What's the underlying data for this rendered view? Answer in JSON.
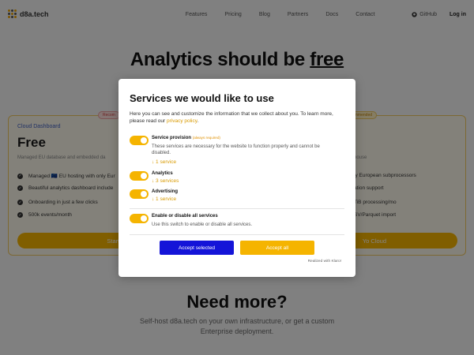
{
  "nav": {
    "logo": "d8a.tech",
    "links": [
      "Features",
      "Pricing",
      "Blog",
      "Partners",
      "Docs",
      "Contact"
    ],
    "github": "GitHub",
    "login": "Log in"
  },
  "hero": {
    "title_prefix": "Analytics should be ",
    "title_emph": "free"
  },
  "cards": {
    "left": {
      "ribbon": "Recom",
      "label": "Cloud Dashboard",
      "title": "Free",
      "sub": "Managed EU database and embedded da",
      "features": [
        "Managed 🇪🇺 EU hosting with only Eur",
        "Beautiful analytics dashboard include",
        "Onboarding in just a few clicks",
        "500k events/month"
      ],
      "button": "Start with"
    },
    "right": {
      "ribbon": "mmended",
      "sub": "house",
      "features": [
        "ly European subprocessors",
        "ation support",
        "TiB processing/mo",
        "SV/Parquet import"
      ],
      "button": "Yo Cloud"
    }
  },
  "bottom": {
    "title": "Need more?",
    "sub": "Self-host d8a.tech on your own infrastructure, or get a custom Enterprise deployment."
  },
  "consent": {
    "title": "Services we would like to use",
    "intro": "Here you can see and customize the information that we collect about you. To learn more, please read our ",
    "privacy_link": "privacy policy",
    "intro_end": ".",
    "services": [
      {
        "name": "Service provision",
        "required": "(always required)",
        "desc": "These services are necessary for the website to function properly and cannot be disabled.",
        "count": "↓ 1 service",
        "enabled": true
      },
      {
        "name": "Analytics",
        "count": "↓ 3 services",
        "enabled": true
      },
      {
        "name": "Advertising",
        "count": "↓ 1 service",
        "enabled": true
      }
    ],
    "all": {
      "name": "Enable or disable all services",
      "desc": "Use this switch to enable or disable all services.",
      "enabled": true
    },
    "accept_selected": "Accept selected",
    "accept_all": "Accept all",
    "realized": "Realized with Klaro!"
  },
  "colors": {
    "accent": "#f5b400",
    "primary_button": "#1414d8",
    "link": "#d89a00"
  }
}
